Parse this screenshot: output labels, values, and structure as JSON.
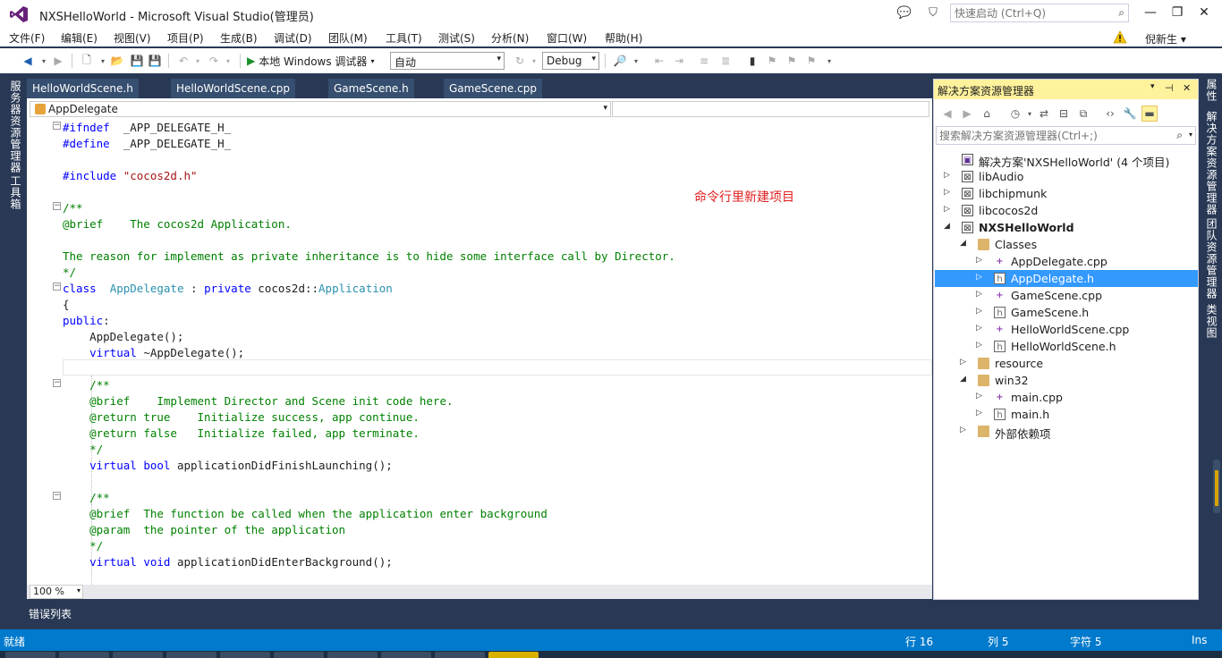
{
  "window": {
    "title": "NXSHelloWorld - Microsoft Visual Studio(管理员)",
    "quick_launch_placeholder": "快速启动 (Ctrl+Q)",
    "user_name": "倪新生 ▾"
  },
  "menu": [
    "文件(F)",
    "编辑(E)",
    "视图(V)",
    "项目(P)",
    "生成(B)",
    "调试(D)",
    "团队(M)",
    "工具(T)",
    "测试(S)",
    "分析(N)",
    "窗口(W)",
    "帮助(H)"
  ],
  "toolbar": {
    "debugger_label": "本地 Windows 调试器",
    "platform": "自动",
    "configuration": "Debug"
  },
  "left_panels": [
    "服务器资源管理器",
    "工具箱"
  ],
  "right_panels": [
    "属性",
    "解决方案资源管理器",
    "团队资源管理器",
    "类视图"
  ],
  "doc_tabs": [
    "HelloWorldScene.h",
    "HelloWorldScene.cpp",
    "GameScene.h",
    "GameScene.cpp"
  ],
  "navigation": {
    "class_scope": "AppDelegate"
  },
  "editor": {
    "annotation": "命令行里新建项目",
    "zoom": "100 %",
    "lines": [
      [
        [
          "pp",
          "#ifndef"
        ],
        [
          "tx",
          "  _APP_DELEGATE_H_"
        ]
      ],
      [
        [
          "pp",
          "#define"
        ],
        [
          "tx",
          "  _APP_DELEGATE_H_"
        ]
      ],
      [],
      [
        [
          "pp",
          "#include "
        ],
        [
          "st",
          "\"cocos2d.h\""
        ]
      ],
      [],
      [
        [
          "cm",
          "/**"
        ]
      ],
      [
        [
          "cm",
          "@brief    The cocos2d Application."
        ]
      ],
      [],
      [
        [
          "cm",
          "The reason for implement as private inheritance is to hide some interface call by Director."
        ]
      ],
      [
        [
          "cm",
          "*/"
        ]
      ],
      [
        [
          "kw",
          "class"
        ],
        [
          "tx",
          "  "
        ],
        [
          "ty",
          "AppDelegate"
        ],
        [
          "tx",
          " : "
        ],
        [
          "kw",
          "private"
        ],
        [
          "tx",
          " cocos2d::"
        ],
        [
          "ty",
          "Application"
        ]
      ],
      [
        [
          "tx",
          "{"
        ]
      ],
      [
        [
          "kw",
          "public"
        ],
        [
          "tx",
          ":"
        ]
      ],
      [
        [
          "tx",
          "    AppDelegate();"
        ]
      ],
      [
        [
          "tx",
          "    "
        ],
        [
          "kw",
          "virtual"
        ],
        [
          "tx",
          " ~AppDelegate();"
        ]
      ],
      [],
      [
        [
          "tx",
          "    "
        ],
        [
          "cm",
          "/**"
        ]
      ],
      [
        [
          "tx",
          "    "
        ],
        [
          "cm",
          "@brief    Implement Director and Scene init code here."
        ]
      ],
      [
        [
          "tx",
          "    "
        ],
        [
          "cm",
          "@return true    Initialize success, app continue."
        ]
      ],
      [
        [
          "tx",
          "    "
        ],
        [
          "cm",
          "@return false   Initialize failed, app terminate."
        ]
      ],
      [
        [
          "tx",
          "    "
        ],
        [
          "cm",
          "*/"
        ]
      ],
      [
        [
          "tx",
          "    "
        ],
        [
          "kw",
          "virtual"
        ],
        [
          "tx",
          " "
        ],
        [
          "kw",
          "bool"
        ],
        [
          "tx",
          " applicationDidFinishLaunching();"
        ]
      ],
      [],
      [
        [
          "tx",
          "    "
        ],
        [
          "cm",
          "/**"
        ]
      ],
      [
        [
          "tx",
          "    "
        ],
        [
          "cm",
          "@brief  The function be called when the application enter background"
        ]
      ],
      [
        [
          "tx",
          "    "
        ],
        [
          "cm",
          "@param  the pointer of the application"
        ]
      ],
      [
        [
          "tx",
          "    "
        ],
        [
          "cm",
          "*/"
        ]
      ],
      [
        [
          "tx",
          "    "
        ],
        [
          "kw",
          "virtual"
        ],
        [
          "tx",
          " "
        ],
        [
          "kw",
          "void"
        ],
        [
          "tx",
          " applicationDidEnterBackground();"
        ]
      ]
    ]
  },
  "error_list_tab": "错误列表",
  "solution_explorer": {
    "title": "解决方案资源管理器",
    "search_placeholder": "搜索解决方案资源管理器(Ctrl+;)",
    "tree": [
      {
        "label": "解决方案'NXSHelloWorld' (4 个项目)",
        "level": 0,
        "icon": "solution",
        "expander": "none"
      },
      {
        "label": "libAudio",
        "level": 0,
        "icon": "project",
        "expander": "collapsed"
      },
      {
        "label": "libchipmunk",
        "level": 0,
        "icon": "project",
        "expander": "collapsed"
      },
      {
        "label": "libcocos2d",
        "level": 0,
        "icon": "project",
        "expander": "collapsed"
      },
      {
        "label": "NXSHelloWorld",
        "level": 0,
        "icon": "project",
        "expander": "expanded",
        "bold": true
      },
      {
        "label": "Classes",
        "level": 1,
        "icon": "folder",
        "expander": "expanded"
      },
      {
        "label": "AppDelegate.cpp",
        "level": 2,
        "icon": "cpp",
        "expander": "collapsed"
      },
      {
        "label": "AppDelegate.h",
        "level": 2,
        "icon": "h",
        "expander": "collapsed",
        "selected": true
      },
      {
        "label": "GameScene.cpp",
        "level": 2,
        "icon": "cpp",
        "expander": "collapsed"
      },
      {
        "label": "GameScene.h",
        "level": 2,
        "icon": "h",
        "expander": "collapsed"
      },
      {
        "label": "HelloWorldScene.cpp",
        "level": 2,
        "icon": "cpp",
        "expander": "collapsed"
      },
      {
        "label": "HelloWorldScene.h",
        "level": 2,
        "icon": "h",
        "expander": "collapsed"
      },
      {
        "label": "resource",
        "level": 1,
        "icon": "folder",
        "expander": "collapsed"
      },
      {
        "label": "win32",
        "level": 1,
        "icon": "folder",
        "expander": "expanded"
      },
      {
        "label": "main.cpp",
        "level": 2,
        "icon": "cpp",
        "expander": "collapsed"
      },
      {
        "label": "main.h",
        "level": 2,
        "icon": "h",
        "expander": "collapsed"
      },
      {
        "label": "外部依赖项",
        "level": 1,
        "icon": "folder",
        "expander": "collapsed"
      }
    ]
  },
  "statusbar": {
    "state": "就绪",
    "line": "行 16",
    "col": "列 5",
    "char": "字符 5",
    "mode": "Ins"
  },
  "colors": {
    "accent": "#007acc",
    "frame": "#293955",
    "selection": "#3399ff",
    "panel_header": "#fff29d",
    "annotation": "#e02020"
  }
}
